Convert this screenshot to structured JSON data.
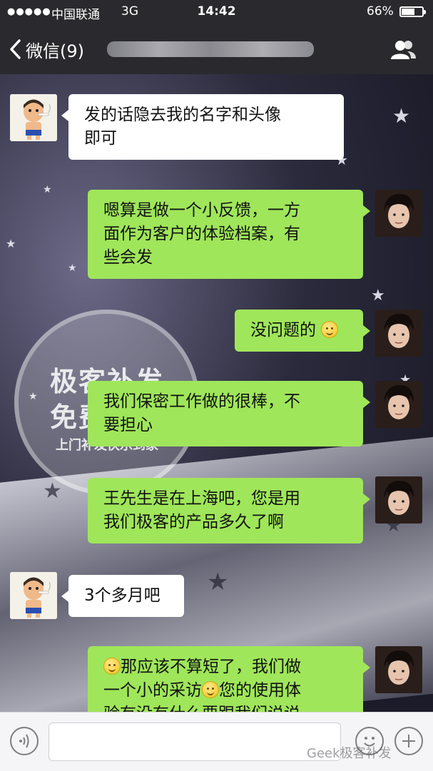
{
  "status_bar": {
    "signal": "●●●●●",
    "carrier": "中国联通",
    "network": "3G",
    "time": "14:42",
    "battery": "66%"
  },
  "nav": {
    "back_label": "微信(9)",
    "contacts_icon": "contacts-icon"
  },
  "watermark": {
    "line1": "极客补发",
    "line2": "免费试用",
    "line3": "上门补发快乐到家"
  },
  "messages": [
    {
      "side": "other",
      "lines": [
        "发的话隐去我的名字和头像",
        "即可"
      ]
    },
    {
      "side": "self",
      "lines": [
        "嗯算是做一个小反馈，一方",
        "面作为客户的体验档案，有",
        "些会发"
      ]
    },
    {
      "side": "self",
      "lines": [
        "没问题的"
      ],
      "emoji_suffix": true
    },
    {
      "side": "self",
      "lines": [
        "我们保密工作做的很棒，不",
        "要担心"
      ]
    },
    {
      "side": "self",
      "lines": [
        "王先生是在上海吧，您是用",
        "我们极客的产品多久了啊"
      ]
    },
    {
      "side": "other",
      "lines": [
        "3个多月吧"
      ]
    },
    {
      "side": "self",
      "lines": [
        "那应该不算短了，我们做",
        "一个小的采访",
        "您的使用体",
        "验有没有什么要跟我们说说"
      ]
    }
  ],
  "input_bar": {
    "placeholder": "",
    "source_mark": "Geek极客补发"
  },
  "colors": {
    "self_bubble": "#9fe65a",
    "other_bubble": "#ffffff",
    "nav_background": "#2a2a2e"
  }
}
